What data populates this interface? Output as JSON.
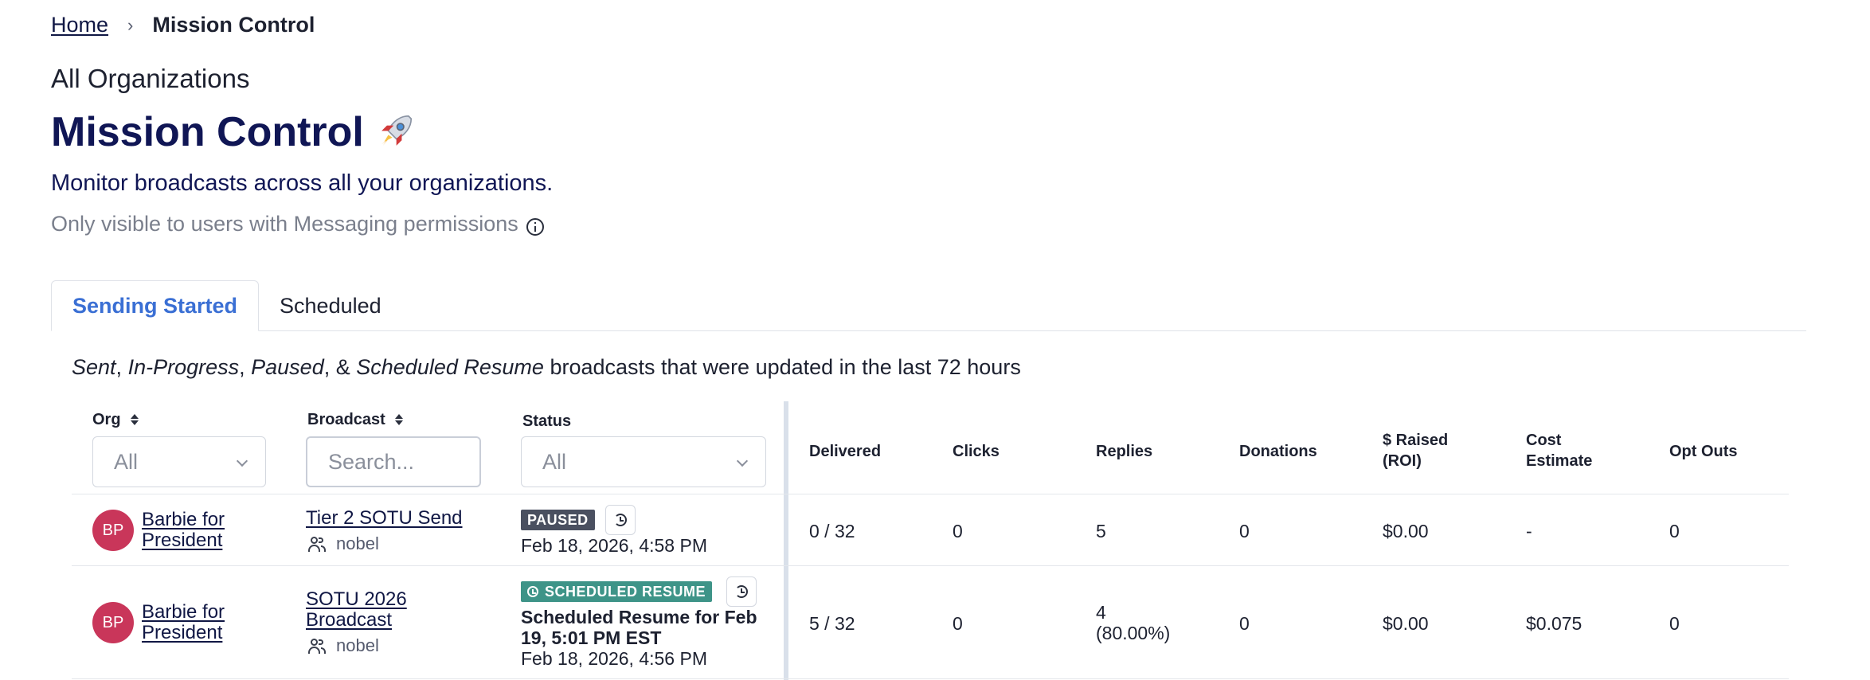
{
  "breadcrumb": {
    "home": "Home",
    "separator": "›",
    "current": "Mission Control"
  },
  "org_heading": "All Organizations",
  "title": "Mission Control",
  "title_icon": "rocket-icon",
  "subtitle": "Monitor broadcasts across all your organizations.",
  "permission_note": "Only visible to users with Messaging permissions",
  "tabs": [
    {
      "label": "Sending Started",
      "active": true
    },
    {
      "label": "Scheduled",
      "active": false
    }
  ],
  "description": {
    "sent": "Sent",
    "in_progress": "In-Progress",
    "paused": "Paused",
    "amp": "&",
    "scheduled_resume": "Scheduled Resume",
    "rest": "broadcasts that were updated in the last 72 hours"
  },
  "columns": {
    "org": "Org",
    "broadcast": "Broadcast",
    "status": "Status",
    "delivered": "Delivered",
    "clicks": "Clicks",
    "replies": "Replies",
    "donations": "Donations",
    "raised_line1": "$ Raised",
    "raised_line2": "(ROI)",
    "cost_line1": "Cost",
    "cost_line2": "Estimate",
    "opt_outs": "Opt Outs"
  },
  "filters": {
    "org": "All",
    "broadcast_placeholder": "Search...",
    "status": "All"
  },
  "rows": [
    {
      "avatar": "BP",
      "org_line1": "Barbie for",
      "org_line2": "President",
      "broadcast_line1": "Tier 2 SOTU Send",
      "broadcast_line2": "",
      "owner": "nobel",
      "badge": "PAUSED",
      "scheduled_line1": "",
      "scheduled_line2": "",
      "time": "Feb 18, 2026, 4:58 PM",
      "delivered": "0 / 32",
      "clicks": "0",
      "replies_line1": "5",
      "replies_line2": "",
      "donations": "0",
      "raised": "$0.00",
      "cost": "-",
      "opt_outs": "0"
    },
    {
      "avatar": "BP",
      "org_line1": "Barbie for",
      "org_line2": "President",
      "broadcast_line1": "SOTU 2026",
      "broadcast_line2": "Broadcast",
      "owner": "nobel",
      "badge": "SCHEDULED RESUME",
      "scheduled_line1": "Scheduled Resume for Feb",
      "scheduled_line2": "19, 5:01 PM EST",
      "time": "Feb 18, 2026, 4:56 PM",
      "delivered": "5 / 32",
      "clicks": "0",
      "replies_line1": "4",
      "replies_line2": "(80.00%)",
      "donations": "0",
      "raised": "$0.00",
      "cost": "$0.075",
      "opt_outs": "0"
    }
  ],
  "colors": {
    "primary_navy": "#101655",
    "active_tab": "#3a6fd4",
    "avatar_bg": "#c9365a",
    "paused_badge": "#4a5060",
    "scheduled_badge": "#3e9488"
  }
}
